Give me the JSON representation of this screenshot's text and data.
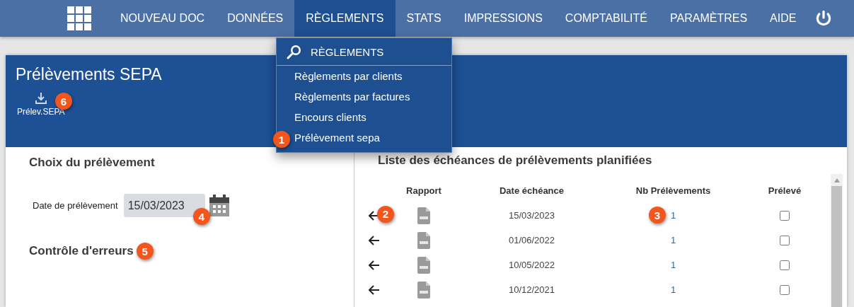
{
  "nav": {
    "items": [
      {
        "label": "NOUVEAU DOC",
        "selected": false
      },
      {
        "label": "DONNÉES",
        "selected": false
      },
      {
        "label": "RÈGLEMENTS",
        "selected": true
      },
      {
        "label": "STATS",
        "selected": false
      },
      {
        "label": "IMPRESSIONS",
        "selected": false
      },
      {
        "label": "COMPTABILITÉ",
        "selected": false
      },
      {
        "label": "PARAMÈTRES",
        "selected": false
      },
      {
        "label": "AIDE",
        "selected": false
      }
    ]
  },
  "menu": {
    "title": "RÈGLEMENTS",
    "items": [
      {
        "label": "Règlements par clients"
      },
      {
        "label": "Règlements par factures"
      },
      {
        "label": "Encours clients"
      },
      {
        "label": "Prélèvement sepa",
        "badge": "1"
      }
    ]
  },
  "panel": {
    "title": "Prélèvements SEPA",
    "toolbar": [
      {
        "label": "Prélev.SEPA",
        "badge": "6"
      }
    ]
  },
  "left": {
    "heading": "Choix du prélèvement",
    "field": {
      "label": "Date de prélèvement",
      "value": "15/03/2023",
      "badge": "4"
    },
    "errors": {
      "heading": "Contrôle d'erreurs",
      "badge": "5"
    }
  },
  "right": {
    "heading": "Liste des échéances de prélèvements planifiées",
    "columns": [
      "Rapport",
      "Date échéance",
      "Nb Prélèvements",
      "Prélevé"
    ],
    "rows": [
      {
        "date": "15/03/2023",
        "count": "1",
        "checked": false,
        "arrow_badge": "2",
        "count_badge": "3"
      },
      {
        "date": "01/06/2022",
        "count": "1",
        "checked": false
      },
      {
        "date": "10/05/2022",
        "count": "1",
        "checked": false
      },
      {
        "date": "10/12/2021",
        "count": "1",
        "checked": false
      }
    ]
  }
}
